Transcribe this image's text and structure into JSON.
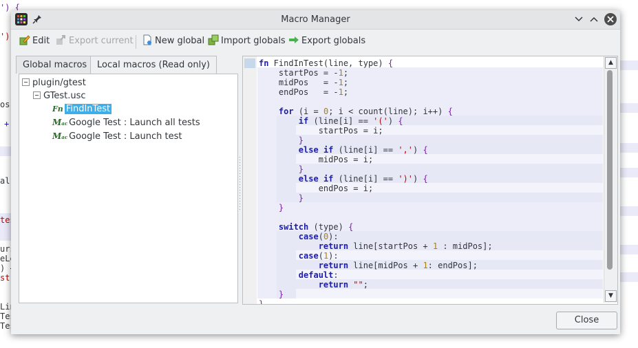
{
  "background": {
    "fragments": [
      "') {",
      "')",
      "os",
      "+",
      "al",
      "tes",
      "urs",
      "eLe",
      ") +",
      "st",
      "Lin",
      "Tes",
      "Tes"
    ]
  },
  "window": {
    "title": "Macro Manager"
  },
  "toolbar": {
    "edit_label": "Edit",
    "export_current_label": "Export current",
    "new_global_label": "New global",
    "import_globals_label": "Import globals",
    "export_globals_label": "Export globals"
  },
  "tabs": {
    "global_label": "Global macros",
    "local_label": "Local macros (Read only)"
  },
  "tree": {
    "root": "plugin/gtest",
    "file": "GTest.usc",
    "items": [
      {
        "icon": "Fn",
        "label": "FindInTest",
        "selected": true
      },
      {
        "icon": "M",
        "label": "Google Test : Launch all tests",
        "selected": false
      },
      {
        "icon": "M",
        "label": "Google Test : Launch test",
        "selected": false
      }
    ]
  },
  "code": {
    "lines": [
      "fn FindInTest(line, type) {",
      "    startPos = -1;",
      "    midPos   = -1;",
      "    endPos   = -1;",
      "",
      "    for (i = 0; i < count(line); i++) {",
      "        if (line[i] == '(') {",
      "            startPos = i;",
      "        }",
      "        else if (line[i] == ',') {",
      "            midPos = i;",
      "        }",
      "        else if (line[i] == ')') {",
      "            endPos = i;",
      "        }",
      "    }",
      "",
      "    switch (type) {",
      "        case(0):",
      "            return line[startPos + 1 : midPos];",
      "        case(1):",
      "            return line[midPos + 1: endPos];",
      "        default:",
      "            return \"\";",
      "    }",
      "}"
    ]
  },
  "footer": {
    "close_label": "Close"
  },
  "icons": {
    "app": "app-grid-icon",
    "pin": "pin-icon",
    "minimize": "chevron-down-icon",
    "maximize": "chevron-up-icon",
    "close": "close-icon",
    "edit": "edit-icon",
    "export_current": "export-current-icon",
    "new_global": "new-document-icon",
    "import_globals": "import-icon",
    "export_globals": "arrow-right-icon"
  },
  "colors": {
    "selection": "#3daee9",
    "keyword": "#1c1cb0",
    "number": "#b08000",
    "string": "#bf0303"
  }
}
